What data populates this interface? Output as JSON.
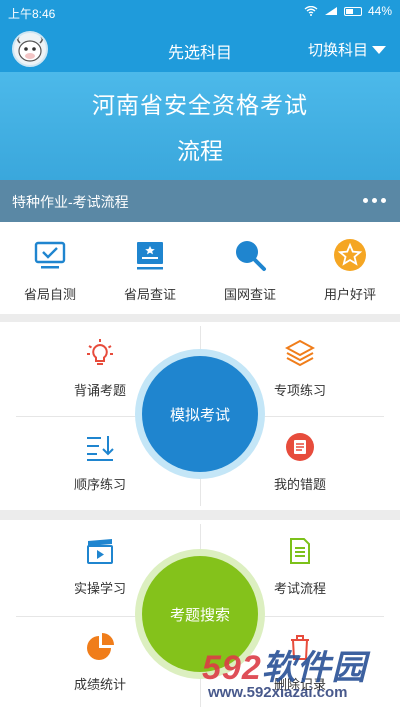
{
  "status": {
    "time": "上午8:46",
    "battery": "44%"
  },
  "header": {
    "title": "先选科目",
    "switch_label": "切换科目"
  },
  "banner": {
    "line1": "河南省安全资格考试",
    "line2": "流程"
  },
  "subbar": {
    "text": "特种作业-考试流程"
  },
  "quick": [
    {
      "label": "省局自测",
      "icon": "monitor-check-icon"
    },
    {
      "label": "省局查证",
      "icon": "certificate-icon"
    },
    {
      "label": "国网查证",
      "icon": "search-icon"
    },
    {
      "label": "用户好评",
      "icon": "star-icon"
    }
  ],
  "section1": {
    "center": "模拟考试",
    "items": [
      {
        "label": "背诵考题",
        "icon": "lightbulb-icon"
      },
      {
        "label": "专项练习",
        "icon": "layers-icon"
      },
      {
        "label": "顺序练习",
        "icon": "sort-list-icon"
      },
      {
        "label": "我的错题",
        "icon": "wrong-book-icon"
      }
    ]
  },
  "section2": {
    "center": "考题搜索",
    "items": [
      {
        "label": "实操学习",
        "icon": "video-clapper-icon"
      },
      {
        "label": "考试流程",
        "icon": "document-icon"
      },
      {
        "label": "成绩统计",
        "icon": "pie-chart-icon"
      },
      {
        "label": "删除记录",
        "icon": "trash-icon"
      }
    ]
  },
  "watermark": {
    "brand": "592软件园",
    "url": "www.592xiazai.com"
  },
  "colors": {
    "primary": "#1f9bdb",
    "accent_blue": "#1f85cf",
    "accent_green": "#84c21b",
    "subbar": "#5a88a5"
  }
}
